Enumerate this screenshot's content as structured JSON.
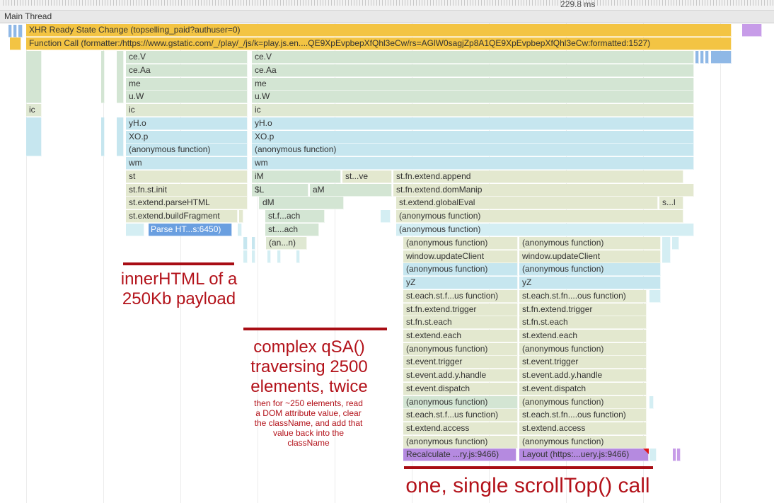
{
  "ruler": {
    "time_label": "229.8 ms"
  },
  "track": {
    "title": "Main Thread"
  },
  "flame": {
    "xhr": "XHR Ready State Change (topselling_paid?authuser=0)",
    "function_call": "Function Call (formatter:/https://www.gstatic.com/_/play/_/js/k=play.js.en....QE9XpEvpbepXfQhl3eCw/rs=AGlW0sagjZp8A1QE9XpEvpbepXfQhl3eCw:formatted:1527)",
    "left_ic": "ic",
    "col_a": [
      "ce.V",
      "ce.Aa",
      "me",
      "u.W",
      "ic",
      "yH.o",
      "XO.p",
      "(anonymous function)",
      "wm",
      "st",
      "st.fn.st.init",
      "st.extend.parseHTML",
      "st.extend.buildFragment",
      "Parse HT...s:6450)"
    ],
    "col_b": [
      "ce.V",
      "ce.Aa",
      "me",
      "u.W",
      "ic",
      "yH.o",
      "XO.p",
      "(anonymous function)",
      "wm",
      "iM",
      "$L",
      "aM",
      "dM",
      "st.f...ach",
      "st....ach",
      "(an...n)",
      "st...ve"
    ],
    "col_c": [
      "st.fn.extend.append",
      "st.fn.extend.domManip",
      "st.extend.globalEval",
      "s...l",
      "(anonymous function)",
      "(anonymous function)"
    ],
    "col_d": [
      "(anonymous function)",
      "window.updateClient",
      "(anonymous function)",
      "yZ",
      "st.each.st.f...us function)",
      "st.fn.extend.trigger",
      "st.fn.st.each",
      "st.extend.each",
      "(anonymous function)",
      "st.event.trigger",
      "st.event.add.y.handle",
      "st.event.dispatch",
      "(anonymous function)",
      "st.each.st.f...us function)",
      "st.extend.access",
      "(anonymous function)",
      "Recalculate ...ry.js:9466)"
    ],
    "col_e": [
      "(anonymous function)",
      "window.updateClient",
      "(anonymous function)",
      "yZ",
      "st.each.st.fn....ous function)",
      "st.fn.extend.trigger",
      "st.fn.st.each",
      "st.extend.each",
      "(anonymous function)",
      "st.event.trigger",
      "st.event.add.y.handle",
      "st.event.dispatch",
      "(anonymous function)",
      "st.each.st.fn....ous function)",
      "st.extend.access",
      "(anonymous function)",
      "Layout (https:...uery.js:9466)"
    ]
  },
  "annotations": {
    "inner_html": [
      "innerHTML of a",
      "250Kb payload"
    ],
    "qsa": [
      "complex qSA()",
      "traversing 2500",
      "elements, twice"
    ],
    "qsa_note": [
      "then for ~250 elements, read",
      "a DOM attribute value, clear",
      "the className, and add that",
      "value back into the",
      "className"
    ],
    "scroll": "one, single scrollTop() call"
  },
  "colors": {
    "annotation_red": "#b3121a",
    "xhr_yellow": "#f3c443",
    "layout_purple": "#b58ae0",
    "scripting_green": "#d3e5d3",
    "scripting_blue": "#c6e6ef"
  }
}
